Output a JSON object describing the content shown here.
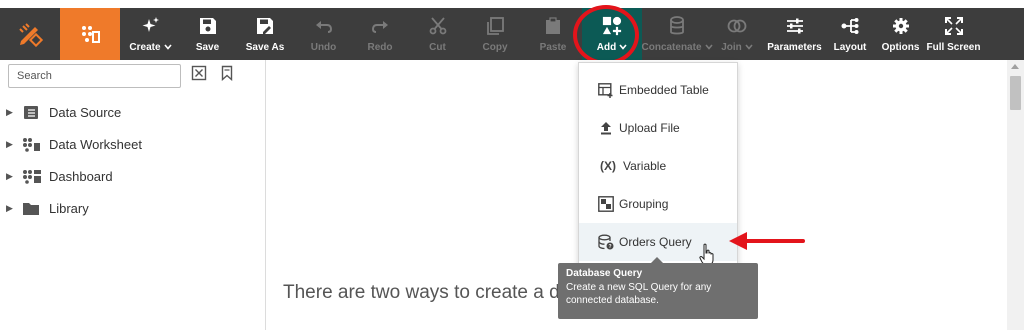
{
  "toolbar": {
    "buttons": [
      {
        "label": "Create",
        "caret": true,
        "enabled": true
      },
      {
        "label": "Save",
        "caret": false,
        "enabled": true
      },
      {
        "label": "Save As",
        "caret": false,
        "enabled": true
      },
      {
        "label": "Undo",
        "caret": false,
        "enabled": false
      },
      {
        "label": "Redo",
        "caret": false,
        "enabled": false
      },
      {
        "label": "Cut",
        "caret": false,
        "enabled": false
      },
      {
        "label": "Copy",
        "caret": false,
        "enabled": false
      },
      {
        "label": "Paste",
        "caret": false,
        "enabled": false
      },
      {
        "label": "Add",
        "caret": true,
        "enabled": true,
        "active": true
      },
      {
        "label": "Concatenate",
        "caret": true,
        "enabled": false
      },
      {
        "label": "Join",
        "caret": true,
        "enabled": false
      },
      {
        "label": "Parameters",
        "caret": false,
        "enabled": true
      },
      {
        "label": "Layout",
        "caret": false,
        "enabled": true
      },
      {
        "label": "Options",
        "caret": false,
        "enabled": true
      },
      {
        "label": "Full Screen",
        "caret": false,
        "enabled": true
      }
    ],
    "caret_glyph": "⌄"
  },
  "sidebar": {
    "search_placeholder": "Search",
    "items": [
      {
        "label": "Data Source",
        "icon": "database-icon"
      },
      {
        "label": "Data Worksheet",
        "icon": "worksheet-icon"
      },
      {
        "label": "Dashboard",
        "icon": "dashboard-icon"
      },
      {
        "label": "Library",
        "icon": "folder-icon"
      }
    ]
  },
  "main": {
    "hint_text": "There are two ways to create a data block."
  },
  "add_menu": {
    "items": [
      {
        "label": "Embedded Table",
        "icon": "embedded-table-icon"
      },
      {
        "label": "Upload File",
        "icon": "upload-icon"
      },
      {
        "label": "Variable",
        "icon": "variable-icon",
        "glyph": "(X)"
      },
      {
        "label": "Grouping",
        "icon": "grouping-icon"
      },
      {
        "label": "Orders Query",
        "icon": "database-query-icon"
      }
    ]
  },
  "tooltip": {
    "title": "Database Query",
    "body": "Create a new SQL Query for any connected database."
  },
  "colors": {
    "toolbar_bg": "#3d3d3d",
    "brand_orange": "#ef7a2a",
    "active_teal": "#0c5a55",
    "annotation_red": "#e3141b"
  }
}
